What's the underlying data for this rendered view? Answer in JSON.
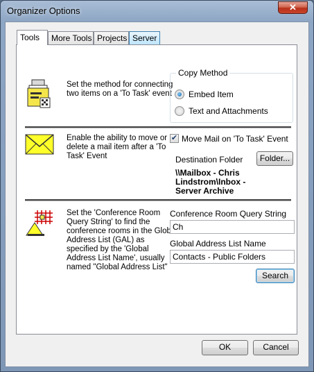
{
  "window": {
    "title": "Organizer Options",
    "close_glyph": "✕"
  },
  "tabs": [
    {
      "label": "Tools",
      "active": true
    },
    {
      "label": "More Tools",
      "active": false
    },
    {
      "label": "Projects",
      "active": false
    },
    {
      "label": "Server",
      "active": false
    }
  ],
  "section1": {
    "description": "Set the method for connecting two items on a 'To Task' event",
    "icon": "task-clipboard-icon",
    "copy_method": {
      "label": "Copy Method",
      "options": [
        {
          "label": "Embed Item",
          "selected": true
        },
        {
          "label": "Text and Attachments",
          "selected": false
        }
      ]
    }
  },
  "section2": {
    "description": "Enable the ability to move or delete a mail item after a 'To Task' Event",
    "icon": "envelope-icon",
    "move_mail": {
      "label": "Move Mail on 'To Task' Event",
      "checked": true,
      "check_glyph": "✔"
    },
    "destination_label": "Destination Folder",
    "folder_button": "Folder...",
    "destination_path": "\\\\Mailbox - Chris Lindstrom\\Inbox - Server Archive"
  },
  "section3": {
    "description": "Set the 'Conference Room Query String' to find the conference rooms in the Global Address List (GAL) as specified by the 'Global Address List Name', usually named \"Global Address List\"",
    "icon": "conference-room-icon",
    "query_label": "Conference Room Query String",
    "query_value": "Ch",
    "gal_label": "Global Address List Name",
    "gal_value": "Contacts - Public Folders",
    "search_button": "Search"
  },
  "footer": {
    "ok": "OK",
    "cancel": "Cancel"
  }
}
